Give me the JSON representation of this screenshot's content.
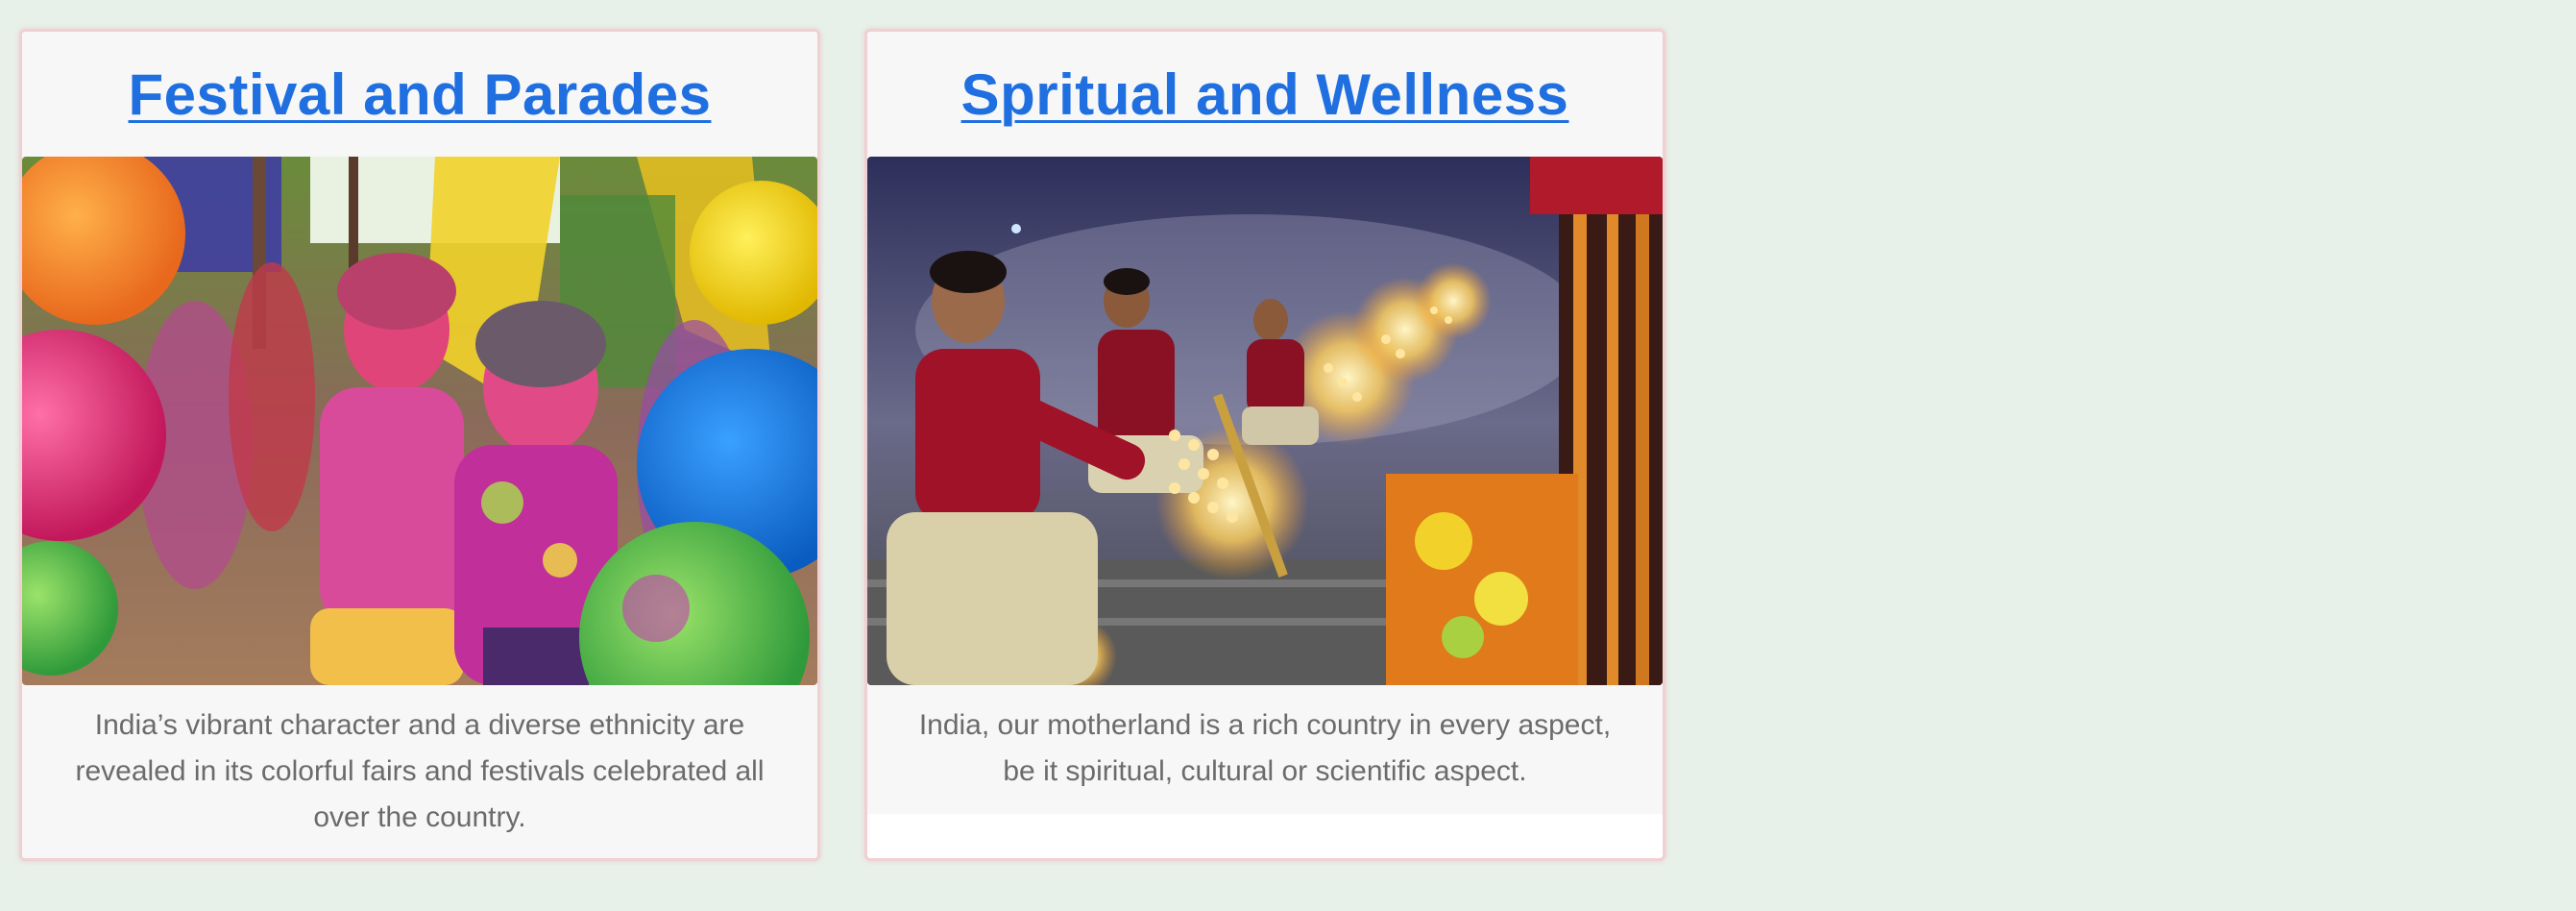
{
  "cards": [
    {
      "title": "Festival and Parades",
      "image_alt": "Children covered in colorful Holi powder",
      "description": "India’s vibrant character and a diverse ethnicity are revealed in its colorful fairs and festivals celebrated all over the country."
    },
    {
      "title": "Spritual and Wellness",
      "image_alt": "Priests performing Ganga aarti with oil lamps",
      "description": "India, our motherland is a rich country in every aspect, be it spiritual, cultural or scientific aspect."
    }
  ],
  "colors": {
    "page_background": "#e8f0ea",
    "card_border": "#f0d0d2",
    "title_link": "#1f6fe0",
    "body_text": "#6b6b6b"
  }
}
